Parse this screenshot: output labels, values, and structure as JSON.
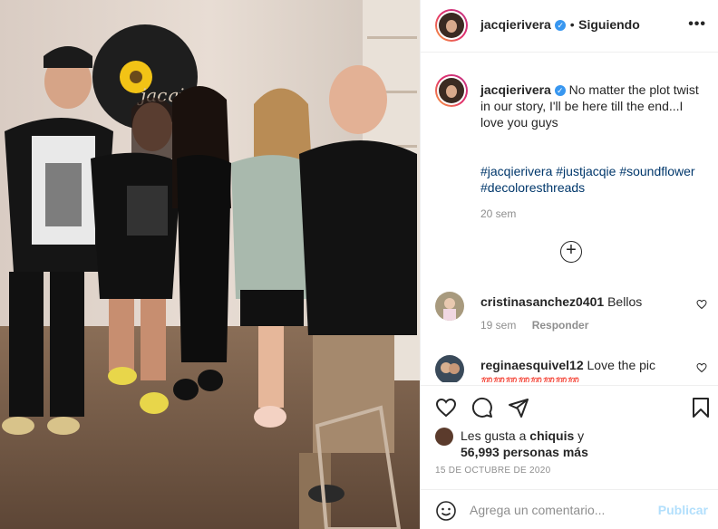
{
  "header": {
    "username": "jacqierivera",
    "verified_glyph": "✓",
    "separator": "•",
    "follow_status": "Siguiendo",
    "more_glyph": "•••"
  },
  "caption": {
    "username": "jacqierivera",
    "text": "No matter the plot twist in our story, I'll be here till the end...I love you guys",
    "hashtags": [
      "#jacqierivera",
      "#justjacqie",
      "#soundflower",
      "#decoloresthreads"
    ],
    "age": "20 sem"
  },
  "load_more_glyph": "+",
  "comments": [
    {
      "username": "cristinasanchez0401",
      "text": "Bellos",
      "age": "19 sem",
      "reply_label": "Responder"
    },
    {
      "username": "reginaesquivel12",
      "text": "Love the pic",
      "emojis": "💯💯💯💯💯💯💯💯"
    }
  ],
  "actions": {
    "icons": [
      "heart-icon",
      "comment-icon",
      "share-icon",
      "bookmark-icon"
    ]
  },
  "likes": {
    "line1_prefix": "Les gusta a ",
    "line1_user": "chiquis",
    "line1_suffix": " y",
    "line2": "56,993 personas más"
  },
  "date": "15 DE OCTUBRE DE 2020",
  "add_comment": {
    "placeholder": "Agrega un comentario...",
    "publish_label": "Publicar"
  },
  "photo": {
    "sign_text": "jacqie"
  },
  "colors": {
    "link_blue": "#00376b",
    "verified_blue": "#3897f0",
    "publish_disabled": "#b2dffc",
    "meta_gray": "#8e8e8e"
  }
}
